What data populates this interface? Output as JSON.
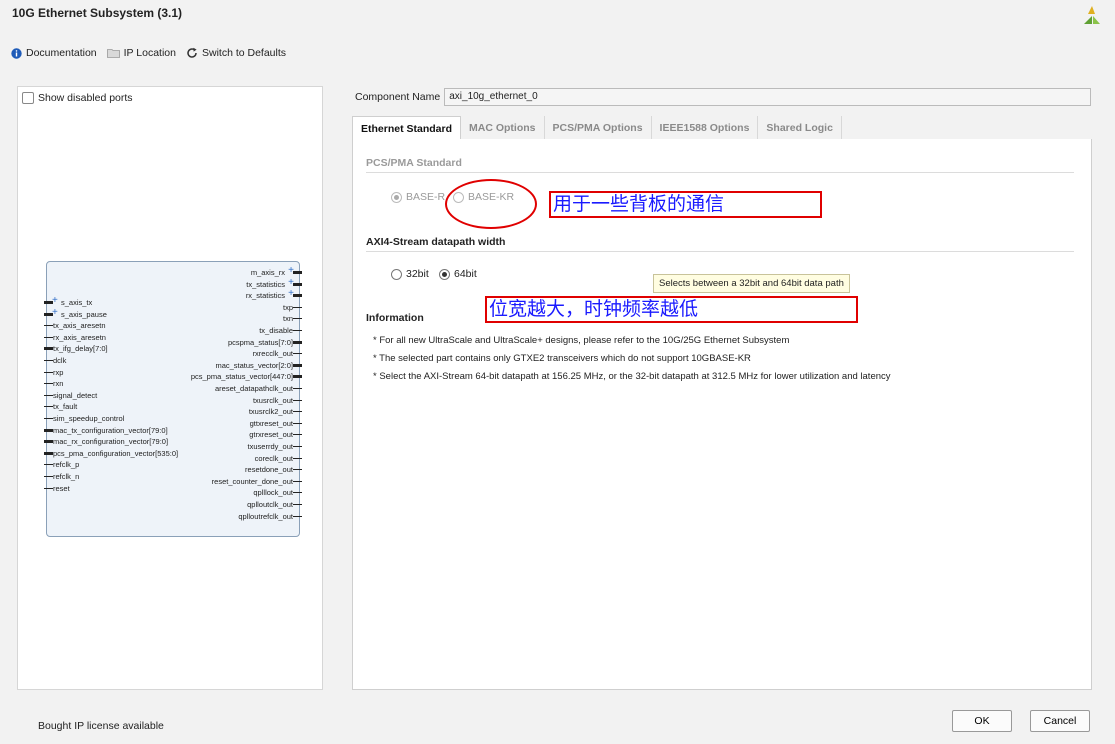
{
  "window": {
    "title": "10G Ethernet Subsystem (3.1)"
  },
  "toolbar": {
    "documentation": "Documentation",
    "ip_location": "IP Location",
    "switch_defaults": "Switch to Defaults"
  },
  "left": {
    "show_disabled_ports": "Show disabled ports",
    "ports_left": [
      {
        "name": "s_axis_tx",
        "plus": true
      },
      {
        "name": "s_axis_pause",
        "plus": true
      },
      {
        "name": "tx_axis_aresetn"
      },
      {
        "name": "rx_axis_aresetn"
      },
      {
        "name": "tx_ifg_delay[7:0]"
      },
      {
        "name": "dclk"
      },
      {
        "name": "rxp"
      },
      {
        "name": "rxn"
      },
      {
        "name": "signal_detect"
      },
      {
        "name": "tx_fault"
      },
      {
        "name": "sim_speedup_control"
      },
      {
        "name": "mac_tx_configuration_vector[79:0]"
      },
      {
        "name": "mac_rx_configuration_vector[79:0]"
      },
      {
        "name": "pcs_pma_configuration_vector[535:0]"
      },
      {
        "name": "refclk_p"
      },
      {
        "name": "refclk_n"
      },
      {
        "name": "reset"
      }
    ],
    "ports_right": [
      {
        "name": "m_axis_rx",
        "plus": true
      },
      {
        "name": "tx_statistics",
        "plus": true
      },
      {
        "name": "rx_statistics",
        "plus": true
      },
      {
        "name": "txp"
      },
      {
        "name": "txn"
      },
      {
        "name": "tx_disable"
      },
      {
        "name": "pcspma_status[7:0]"
      },
      {
        "name": "rxrecclk_out"
      },
      {
        "name": "mac_status_vector[2:0]"
      },
      {
        "name": "pcs_pma_status_vector[447:0]"
      },
      {
        "name": "areset_datapathclk_out"
      },
      {
        "name": "txusrclk_out"
      },
      {
        "name": "txusrclk2_out"
      },
      {
        "name": "gttxreset_out"
      },
      {
        "name": "gtrxreset_out"
      },
      {
        "name": "txuserrdy_out"
      },
      {
        "name": "coreclk_out"
      },
      {
        "name": "resetdone_out"
      },
      {
        "name": "reset_counter_done_out"
      },
      {
        "name": "qplllock_out"
      },
      {
        "name": "qplloutclk_out"
      },
      {
        "name": "qplloutrefclk_out"
      }
    ]
  },
  "component": {
    "label": "Component Name",
    "value": "axi_10g_ethernet_0"
  },
  "tabs": [
    {
      "label": "Ethernet Standard",
      "active": true
    },
    {
      "label": "MAC Options"
    },
    {
      "label": "PCS/PMA Options"
    },
    {
      "label": "IEEE1588 Options"
    },
    {
      "label": "Shared Logic"
    }
  ],
  "pcs_pma": {
    "heading": "PCS/PMA Standard",
    "options": [
      "BASE-R",
      "BASE-KR"
    ]
  },
  "axi": {
    "heading": "AXI4-Stream datapath width",
    "options": [
      "32bit",
      "64bit"
    ],
    "tooltip": "Selects between a 32bit and 64bit data path"
  },
  "annotations": {
    "backplane": "用于一些背板的通信",
    "width_note": "位宽越大，时钟频率越低"
  },
  "information": {
    "heading": "Information",
    "lines": [
      "* For all new UltraScale and UltraScale+ designs, please refer to the 10G/25G Ethernet Subsystem",
      "* The selected part contains only GTXE2 transceivers which do not support 10GBASE-KR",
      "* Select the AXI-Stream 64-bit datapath at 156.25 MHz, or the 32-bit datapath at 312.5 MHz for lower utilization and latency"
    ]
  },
  "footer": {
    "license": "Bought IP license available",
    "ok": "OK",
    "cancel": "Cancel"
  },
  "colors": {
    "annotation_red": "#e00000",
    "annotation_text": "#1a1aff",
    "tooltip_bg": "#fffde1"
  }
}
